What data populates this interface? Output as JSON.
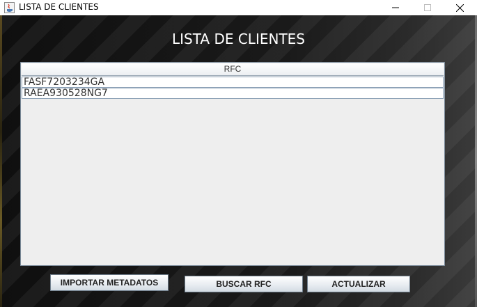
{
  "window": {
    "title": "LISTA DE CLIENTES"
  },
  "heading": "LISTA DE CLIENTES",
  "table": {
    "columns": [
      "RFC"
    ],
    "rows": [
      "FASF7203234GA",
      "RAEA930528NG7"
    ]
  },
  "buttons": {
    "import": "IMPORTAR METADATOS",
    "search": "BUSCAR RFC",
    "refresh": "ACTUALIZAR"
  },
  "icons": {
    "app": "java-cup-icon",
    "minimize": "minimize-icon",
    "maximize": "maximize-icon",
    "close": "close-icon"
  }
}
